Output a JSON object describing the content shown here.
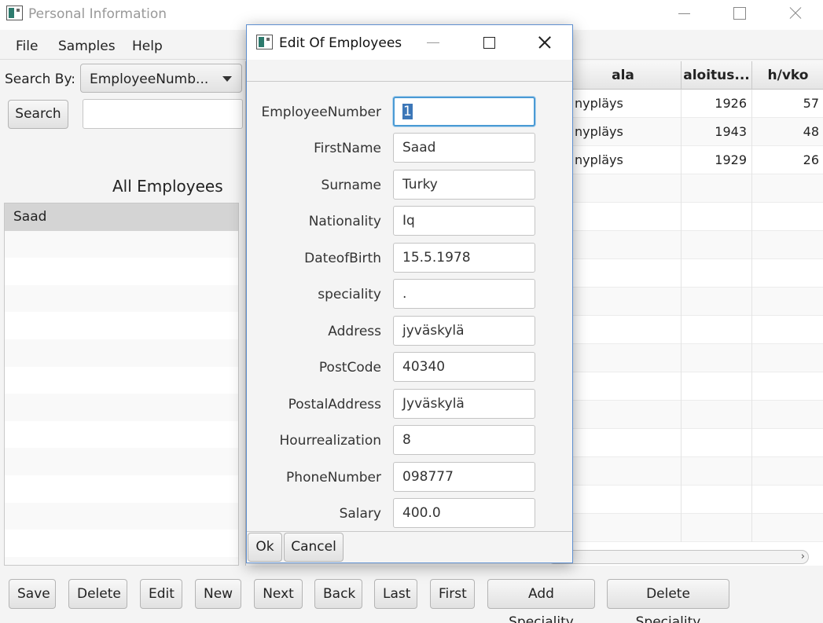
{
  "window": {
    "title": "Personal Information"
  },
  "menu": [
    "File",
    "Samples",
    "Help"
  ],
  "search": {
    "label": "Search By:",
    "combo_value": "EmployeeNumb...",
    "button": "Search",
    "input_value": ""
  },
  "list": {
    "title": "All Employees",
    "items": [
      "Saad"
    ]
  },
  "table": {
    "headers": [
      "ala",
      "aloitus...",
      "h/vko"
    ],
    "rows": [
      [
        "nypläys",
        "1926",
        "57"
      ],
      [
        "nypläys",
        "1943",
        "48"
      ],
      [
        "nypläys",
        "1929",
        "26"
      ]
    ]
  },
  "buttons": [
    "Save",
    "Delete",
    "Edit",
    "New",
    "Next",
    "Back",
    "Last",
    "First",
    "Add Speciality",
    "Delete Speciality"
  ],
  "dialog": {
    "title": "Edit Of Employees",
    "fields": [
      {
        "label": "EmployeeNumber",
        "value": "1"
      },
      {
        "label": "FirstName",
        "value": "Saad"
      },
      {
        "label": "Surname",
        "value": "Turky"
      },
      {
        "label": "Nationality",
        "value": "Iq"
      },
      {
        "label": "DateofBirth",
        "value": "15.5.1978"
      },
      {
        "label": "speciality",
        "value": "."
      },
      {
        "label": "Address",
        "value": "jyväskylä"
      },
      {
        "label": "PostCode",
        "value": "40340"
      },
      {
        "label": "PostalAddress",
        "value": "Jyväskylä"
      },
      {
        "label": "Hourrealization",
        "value": "8"
      },
      {
        "label": "PhoneNumber",
        "value": "098777"
      },
      {
        "label": "Salary",
        "value": "400.0"
      }
    ],
    "ok": "Ok",
    "cancel": "Cancel"
  }
}
